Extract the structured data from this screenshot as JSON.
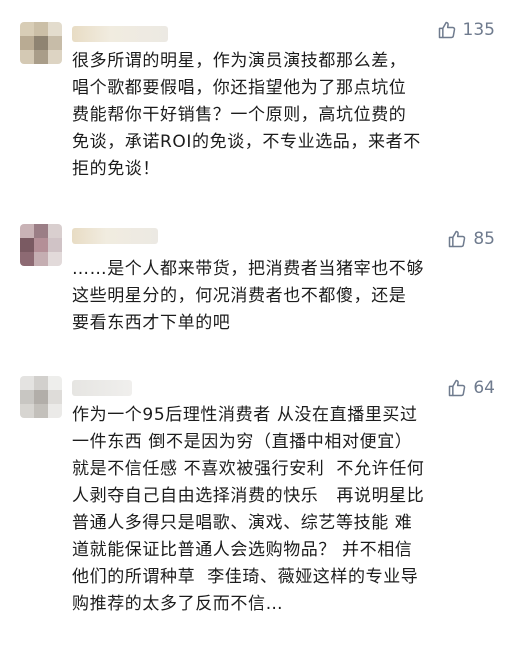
{
  "comments": [
    {
      "likes": "135",
      "text": "很多所谓的明星，作为演员演技都那么差，\n唱个歌都要假唱，你还指望他为了那点坑位\n费能帮你干好销售？一个原则，高坑位费的\n免谈，承诺ROI的免谈，不专业选品，来者不\n拒的免谈！"
    },
    {
      "likes": "85",
      "text": "……是个人都来带货，把消费者当猪宰也不够\n这些明星分的，何况消费者也不都傻，还是\n要看东西才下单的吧"
    },
    {
      "likes": "64",
      "text": "作为一个95后理性消费者 从没在直播里买过\n一件东西 倒不是因为穷（直播中相对便宜）\n就是不信任感 不喜欢被强行安利  不允许任何\n人剥夺自己自由选择消费的快乐   再说明星比\n普通人多得只是唱歌、演戏、综艺等技能 难\n道就能保证比普通人会选购物品？ 并不相信\n他们的所谓种草  李佳琦、薇娅这样的专业导\n购推荐的太多了反而不信…"
    }
  ],
  "colors": {
    "like_gray": "#6f7b8e",
    "text": "#1c1c1c"
  },
  "icons": {
    "like": "thumbs-up-icon"
  }
}
